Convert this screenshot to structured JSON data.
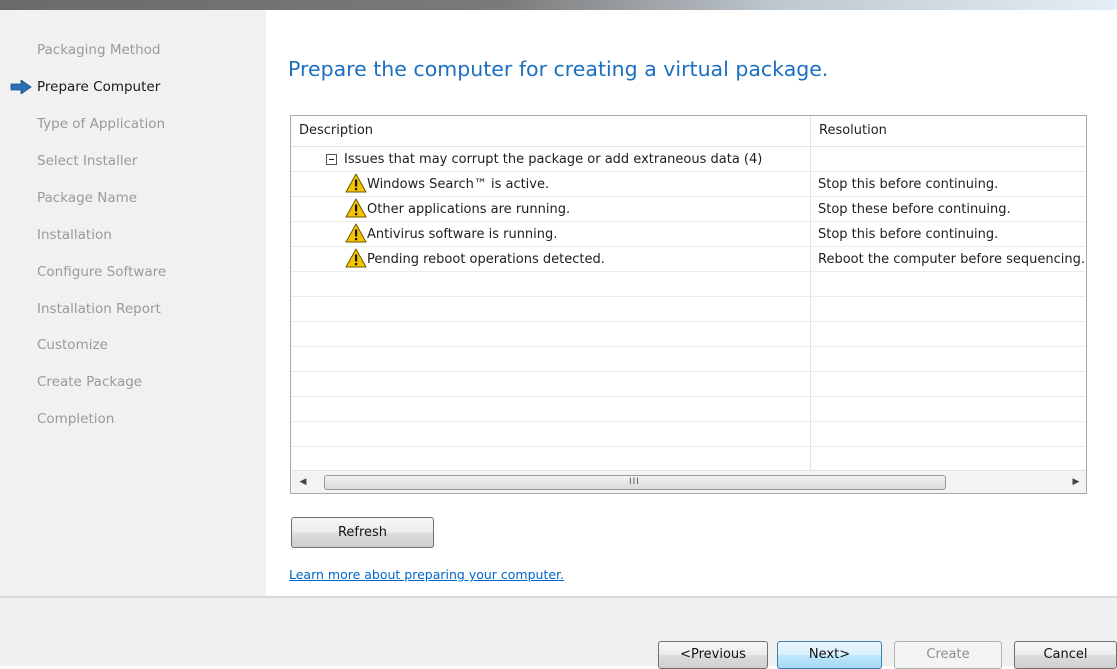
{
  "nav": {
    "current_index": 1,
    "items": [
      {
        "label": "Packaging Method"
      },
      {
        "label": "Prepare Computer"
      },
      {
        "label": "Type of Application"
      },
      {
        "label": "Select Installer"
      },
      {
        "label": "Package Name"
      },
      {
        "label": "Installation"
      },
      {
        "label": "Configure Software"
      },
      {
        "label": "Installation Report"
      },
      {
        "label": "Customize"
      },
      {
        "label": "Create Package"
      },
      {
        "label": "Completion"
      }
    ]
  },
  "page": {
    "title": "Prepare the computer for creating a virtual package."
  },
  "grid": {
    "columns": [
      "Description",
      "Resolution"
    ],
    "group": {
      "label": "Issues that may corrupt the package or add extraneous data (4)",
      "expanded": true
    },
    "rows": [
      {
        "icon": "warning-icon",
        "description": "Windows Search™ is active.",
        "resolution": "Stop this before continuing."
      },
      {
        "icon": "warning-icon",
        "description": "Other applications are running.",
        "resolution": "Stop these before continuing."
      },
      {
        "icon": "warning-icon",
        "description": "Antivirus software is running.",
        "resolution": "Stop this before continuing."
      },
      {
        "icon": "warning-icon",
        "description": "Pending reboot operations detected.",
        "resolution": "Reboot the computer before sequencing."
      }
    ],
    "scroll_grip": "III"
  },
  "actions": {
    "refresh": "Refresh",
    "learn_more": "Learn more about preparing your computer."
  },
  "footer": {
    "previous": "<Previous",
    "next": "Next>",
    "create": "Create",
    "cancel": "Cancel"
  },
  "colors": {
    "title": "#1c6fc0",
    "link": "#0066cc",
    "warning": "#f5c400",
    "nav_arrow": "#2a6fb5"
  }
}
